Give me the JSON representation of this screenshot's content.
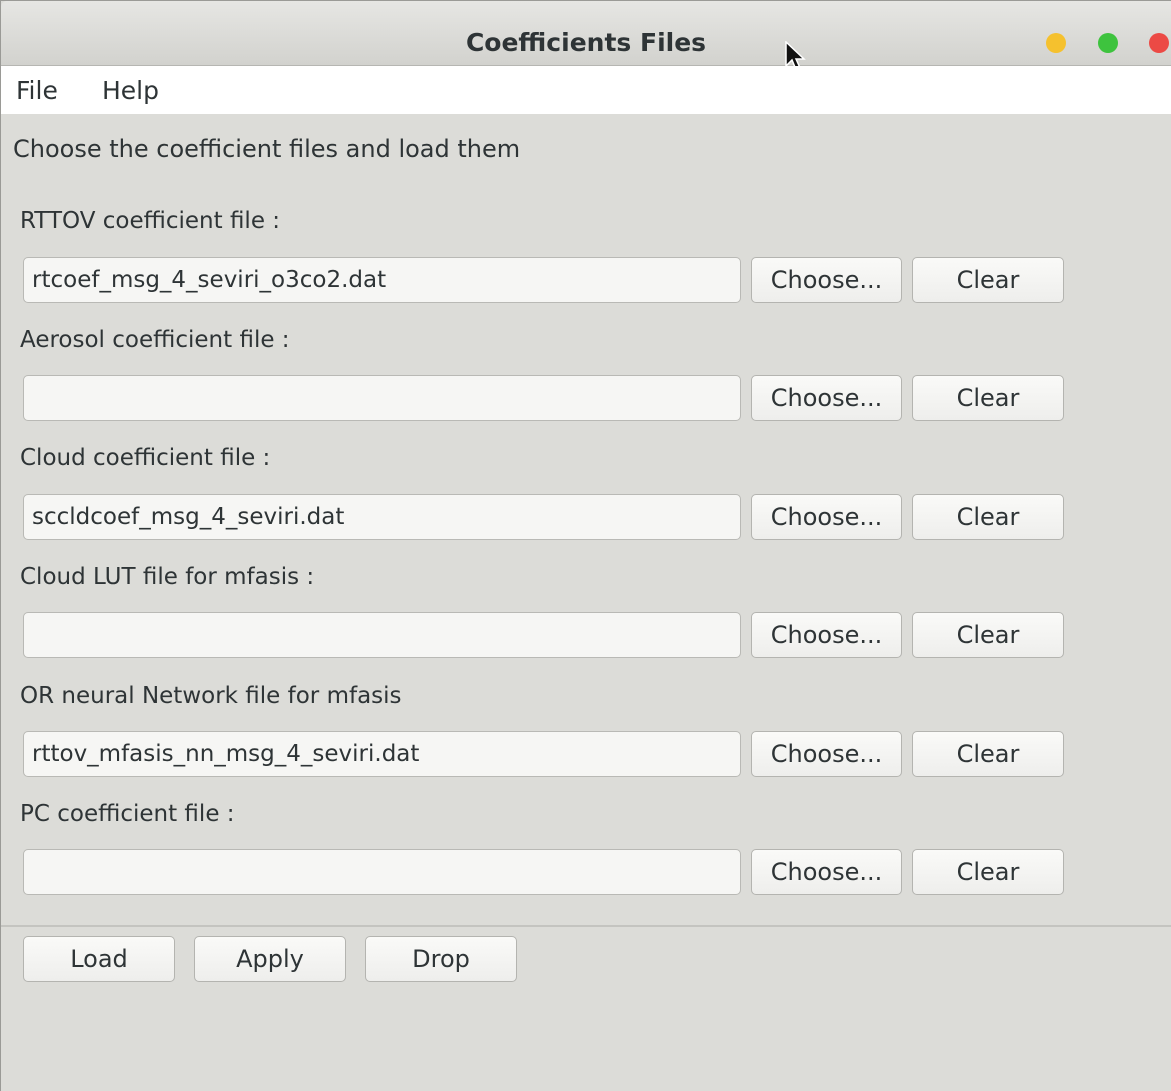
{
  "window": {
    "title": "Coefficients Files"
  },
  "menubar": {
    "items": [
      {
        "label": "File"
      },
      {
        "label": "Help"
      }
    ]
  },
  "heading": "Choose the coefficient files and load them",
  "rows": [
    {
      "label": "RTTOV coefficient file :",
      "value": "rtcoef_msg_4_seviri_o3co2.dat",
      "choose_label": "Choose...",
      "clear_label": "Clear"
    },
    {
      "label": "Aerosol coefficient file :",
      "value": "",
      "choose_label": "Choose...",
      "clear_label": "Clear"
    },
    {
      "label": "Cloud coefficient file :",
      "value": "sccldcoef_msg_4_seviri.dat",
      "choose_label": "Choose...",
      "clear_label": "Clear"
    },
    {
      "label": "Cloud LUT file for mfasis :",
      "value": "",
      "choose_label": "Choose...",
      "clear_label": "Clear"
    },
    {
      "label": "OR neural Network file for mfasis",
      "value": "rttov_mfasis_nn_msg_4_seviri.dat",
      "choose_label": "Choose...",
      "clear_label": "Clear"
    },
    {
      "label": "PC coefficient file :",
      "value": "",
      "choose_label": "Choose...",
      "clear_label": "Clear"
    }
  ],
  "footer": {
    "load_label": "Load",
    "apply_label": "Apply",
    "drop_label": "Drop"
  },
  "colors": {
    "window_bg": "#dcdcd8",
    "minimize": "#f5c12e",
    "maximize": "#3ec33e",
    "close": "#ec4a45"
  },
  "icons": [
    "mouse-pointer-icon"
  ]
}
